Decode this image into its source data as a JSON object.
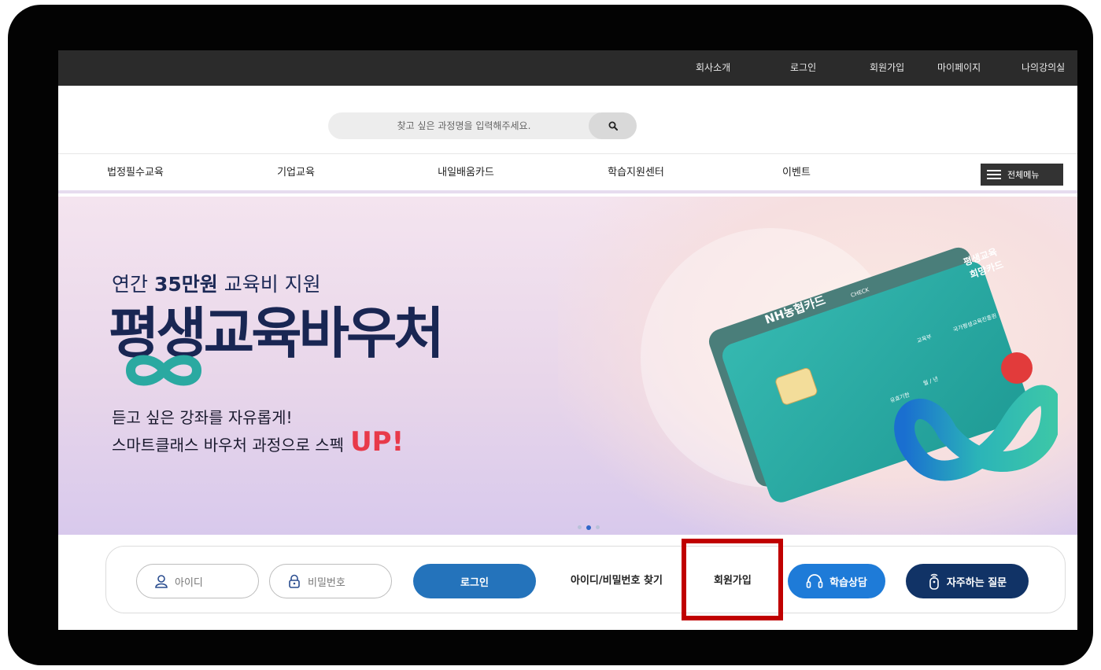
{
  "util_nav": [
    "회사소개",
    "로그인",
    "회원가입",
    "마이페이지",
    "나의강의실"
  ],
  "search": {
    "placeholder": "찾고 싶은 과정명을 입력해주세요."
  },
  "gnb": {
    "items": [
      "법정필수교육",
      "기업교육",
      "내일배움카드",
      "학습지원센터",
      "이벤트"
    ],
    "all_menu": "전체메뉴"
  },
  "banner": {
    "line1_pre": "연간 ",
    "line1_bold": "35만원",
    "line1_post": " 교육비 지원",
    "title": "평생교육바우처",
    "sub1": "듣고 싶은 강좌를 자유롭게!",
    "sub2": "스마트클래스 바우처 과정으로 스펙",
    "sub2_emph": "UP!",
    "card": {
      "bank": "NH농협카드",
      "check": "CHECK",
      "name_line1": "평생교육",
      "name_line2": "희망카드",
      "issuer1": "교육부",
      "issuer2": "국가평생교육진흥원",
      "expiry_label": "유효기한",
      "expiry_mmyy": "월 / 년"
    },
    "slides": {
      "count": 3,
      "active": 1
    }
  },
  "login": {
    "id_placeholder": "아이디",
    "pw_placeholder": "비밀번호",
    "login_btn": "로그인",
    "find_link": "아이디/비밀번호 찾기",
    "join_link": "회원가입",
    "consult_btn": "학습상담",
    "faq_btn": "자주하는 질문"
  },
  "colors": {
    "highlight": "#c00000",
    "login_btn": "#2473bb",
    "consult_btn": "#1e7bd8",
    "faq_btn": "#113366",
    "title_navy": "#192653",
    "up_red": "#e83a4a",
    "card_teal": "#2aa9a1"
  }
}
